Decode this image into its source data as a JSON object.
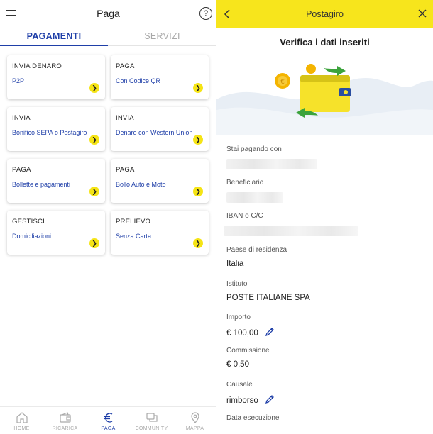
{
  "left": {
    "header": {
      "title": "Paga"
    },
    "tabs": [
      {
        "label": "PAGAMENTI"
      },
      {
        "label": "SERVIZI"
      }
    ],
    "cards": [
      {
        "title": "INVIA DENARO",
        "subtitle": "P2P"
      },
      {
        "title": "PAGA",
        "subtitle": "Con Codice QR"
      },
      {
        "title": "INVIA",
        "subtitle": "Bonifico SEPA o Postagiro"
      },
      {
        "title": "INVIA",
        "subtitle": "Denaro con Western Union"
      },
      {
        "title": "PAGA",
        "subtitle": "Bollette e pagamenti"
      },
      {
        "title": "PAGA",
        "subtitle": "Bollo Auto e Moto"
      },
      {
        "title": "GESTISCI",
        "subtitle": "Domiciliazioni"
      },
      {
        "title": "PRELIEVO",
        "subtitle": "Senza Carta"
      }
    ],
    "nav": [
      {
        "label": "HOME",
        "icon": "home-icon"
      },
      {
        "label": "RICARICA",
        "icon": "wallet-icon"
      },
      {
        "label": "PAGA",
        "icon": "euro-icon",
        "active": true
      },
      {
        "label": "COMMUNITY",
        "icon": "community-icon"
      },
      {
        "label": "MAPPA",
        "icon": "map-pin-icon"
      }
    ]
  },
  "right": {
    "header": {
      "title": "Postagiro"
    },
    "heading": "Verifica i dati inseriti",
    "fields": {
      "payer": {
        "label": "Stai pagando con"
      },
      "beneficiary": {
        "label": "Beneficiario"
      },
      "iban": {
        "label": "IBAN o C/C"
      },
      "country": {
        "label": "Paese di residenza",
        "value": "Italia"
      },
      "institute": {
        "label": "Istituto",
        "value": "POSTE ITALIANE SPA"
      },
      "amount": {
        "label": "Importo",
        "value": "€ 100,00"
      },
      "fee": {
        "label": "Commissione",
        "value": "€ 0,50"
      },
      "reason": {
        "label": "Causale",
        "value": "rimborso"
      },
      "date": {
        "label": "Data esecuzione"
      }
    }
  },
  "colors": {
    "accent_blue": "#1f3fa8",
    "yellow": "#f7e51c"
  }
}
